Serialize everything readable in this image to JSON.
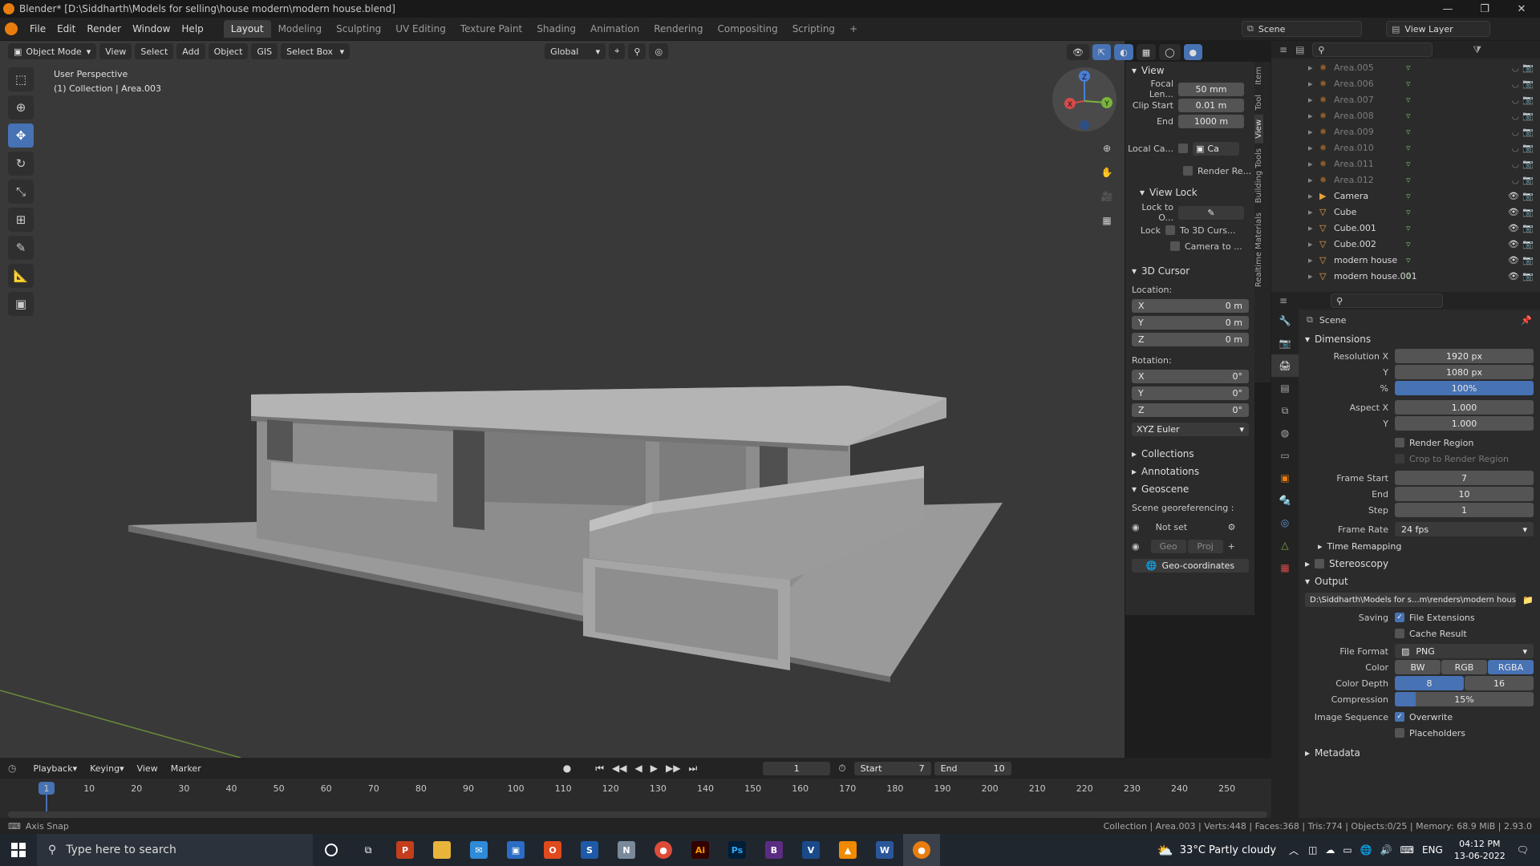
{
  "window": {
    "title": "Blender* [D:\\Siddharth\\Models for selling\\house modern\\modern house.blend]",
    "minimize": "—",
    "maximize": "❐",
    "close": "✕"
  },
  "menu": [
    "File",
    "Edit",
    "Render",
    "Window",
    "Help"
  ],
  "workspaces": [
    "Layout",
    "Modeling",
    "Sculpting",
    "UV Editing",
    "Texture Paint",
    "Shading",
    "Animation",
    "Rendering",
    "Compositing",
    "Scripting"
  ],
  "scene_selector": "Scene",
  "view_layer": "View Layer",
  "viewport_header": {
    "mode": "Object Mode",
    "view": "View",
    "select": "Select",
    "add": "Add",
    "object": "Object",
    "gis": "GIS",
    "select_box": "Select Box",
    "orientation": "Global"
  },
  "viewport": {
    "perspective": "User Perspective",
    "collection": "(1) Collection | Area.003"
  },
  "npanel": {
    "tabs": [
      "Item",
      "Tool",
      "View",
      "Building Tools",
      "Realtime Materials"
    ],
    "view_header": "View",
    "focal_label": "Focal Len...",
    "focal_value": "50 mm",
    "clip_start_label": "Clip Start",
    "clip_start_value": "0.01 m",
    "clip_end_label": "End",
    "clip_end_value": "1000 m",
    "local_camera_label": "Local Ca...",
    "local_camera_value": "Ca",
    "render_region_label": "Render Re...",
    "view_lock_header": "View Lock",
    "lock_to_label": "Lock to O...",
    "lock_label": "Lock",
    "to_3d_cursor": "To 3D Curs...",
    "camera_to": "Camera to ...",
    "cursor_header": "3D Cursor",
    "location_label": "Location:",
    "location": [
      {
        "axis": "X",
        "value": "0 m"
      },
      {
        "axis": "Y",
        "value": "0 m"
      },
      {
        "axis": "Z",
        "value": "0 m"
      }
    ],
    "rotation_label": "Rotation:",
    "rotation": [
      {
        "axis": "X",
        "value": "0°"
      },
      {
        "axis": "Y",
        "value": "0°"
      },
      {
        "axis": "Z",
        "value": "0°"
      }
    ],
    "rotation_mode": "XYZ Euler",
    "collections": "Collections",
    "annotations": "Annotations",
    "geoscene": "Geoscene",
    "georef_label": "Scene georeferencing :",
    "not_set": "Not set",
    "geo": "Geo",
    "proj": "Proj",
    "geo_coords": "Geo-coordinates"
  },
  "outliner": {
    "items": [
      {
        "name": "Area.005",
        "dim": true
      },
      {
        "name": "Area.006",
        "dim": true
      },
      {
        "name": "Area.007",
        "dim": true
      },
      {
        "name": "Area.008",
        "dim": true
      },
      {
        "name": "Area.009",
        "dim": true
      },
      {
        "name": "Area.010",
        "dim": true
      },
      {
        "name": "Area.011",
        "dim": true
      },
      {
        "name": "Area.012",
        "dim": true
      },
      {
        "name": "Camera",
        "dim": false
      },
      {
        "name": "Cube",
        "dim": false
      },
      {
        "name": "Cube.001",
        "dim": false
      },
      {
        "name": "Cube.002",
        "dim": false
      },
      {
        "name": "modern house",
        "dim": false
      },
      {
        "name": "modern house.001",
        "dim": false
      }
    ]
  },
  "properties": {
    "scene": "Scene",
    "dimensions": "Dimensions",
    "res_x_label": "Resolution X",
    "res_x": "1920 px",
    "res_y_label": "Y",
    "res_y": "1080 px",
    "pct_label": "%",
    "pct": "100%",
    "aspect_x_label": "Aspect X",
    "aspect_x": "1.000",
    "aspect_y_label": "Y",
    "aspect_y": "1.000",
    "render_region": "Render Region",
    "crop": "Crop to Render Region",
    "frame_start_label": "Frame Start",
    "frame_start": "7",
    "end_label": "End",
    "end": "10",
    "step_label": "Step",
    "step": "1",
    "frame_rate_label": "Frame Rate",
    "frame_rate": "24 fps",
    "time_remapping": "Time Remapping",
    "stereoscopy": "Stereoscopy",
    "output": "Output",
    "output_path": "D:\\Siddharth\\Models for s...m\\renders\\modern house",
    "saving_label": "Saving",
    "file_extensions": "File Extensions",
    "cache_result": "Cache Result",
    "file_format_label": "File Format",
    "file_format": "PNG",
    "color_label": "Color",
    "color_opts": [
      "BW",
      "RGB",
      "RGBA"
    ],
    "depth_label": "Color Depth",
    "depth_opts": [
      "8",
      "16"
    ],
    "compression_label": "Compression",
    "compression": "15%",
    "compression_fraction": 0.15,
    "img_seq_label": "Image Sequence",
    "overwrite": "Overwrite",
    "placeholders": "Placeholders",
    "metadata": "Metadata"
  },
  "timeline": {
    "menu": [
      "Playback",
      "Keying",
      "View",
      "Marker"
    ],
    "current_frame": "1",
    "start_label": "Start",
    "start": "7",
    "end_label": "End",
    "end": "10",
    "ticks": [
      "1",
      "10",
      "20",
      "30",
      "40",
      "50",
      "60",
      "70",
      "80",
      "90",
      "100",
      "110",
      "120",
      "130",
      "140",
      "150",
      "160",
      "170",
      "180",
      "190",
      "200",
      "210",
      "220",
      "230",
      "240",
      "250"
    ]
  },
  "statusbar": {
    "left": "Axis Snap",
    "right": "Collection | Area.003 | Verts:448 | Faces:368 | Tris:774 | Objects:0/25 | Memory: 68.9 MiB | 2.93.0"
  },
  "taskbar": {
    "search_placeholder": "Type here to search",
    "weather": "33°C  Partly cloudy",
    "lang": "ENG",
    "time": "04:12 PM",
    "date": "13-06-2022"
  },
  "colors": {
    "accent": "#4772b3",
    "blender_orange": "#e87d0d"
  }
}
